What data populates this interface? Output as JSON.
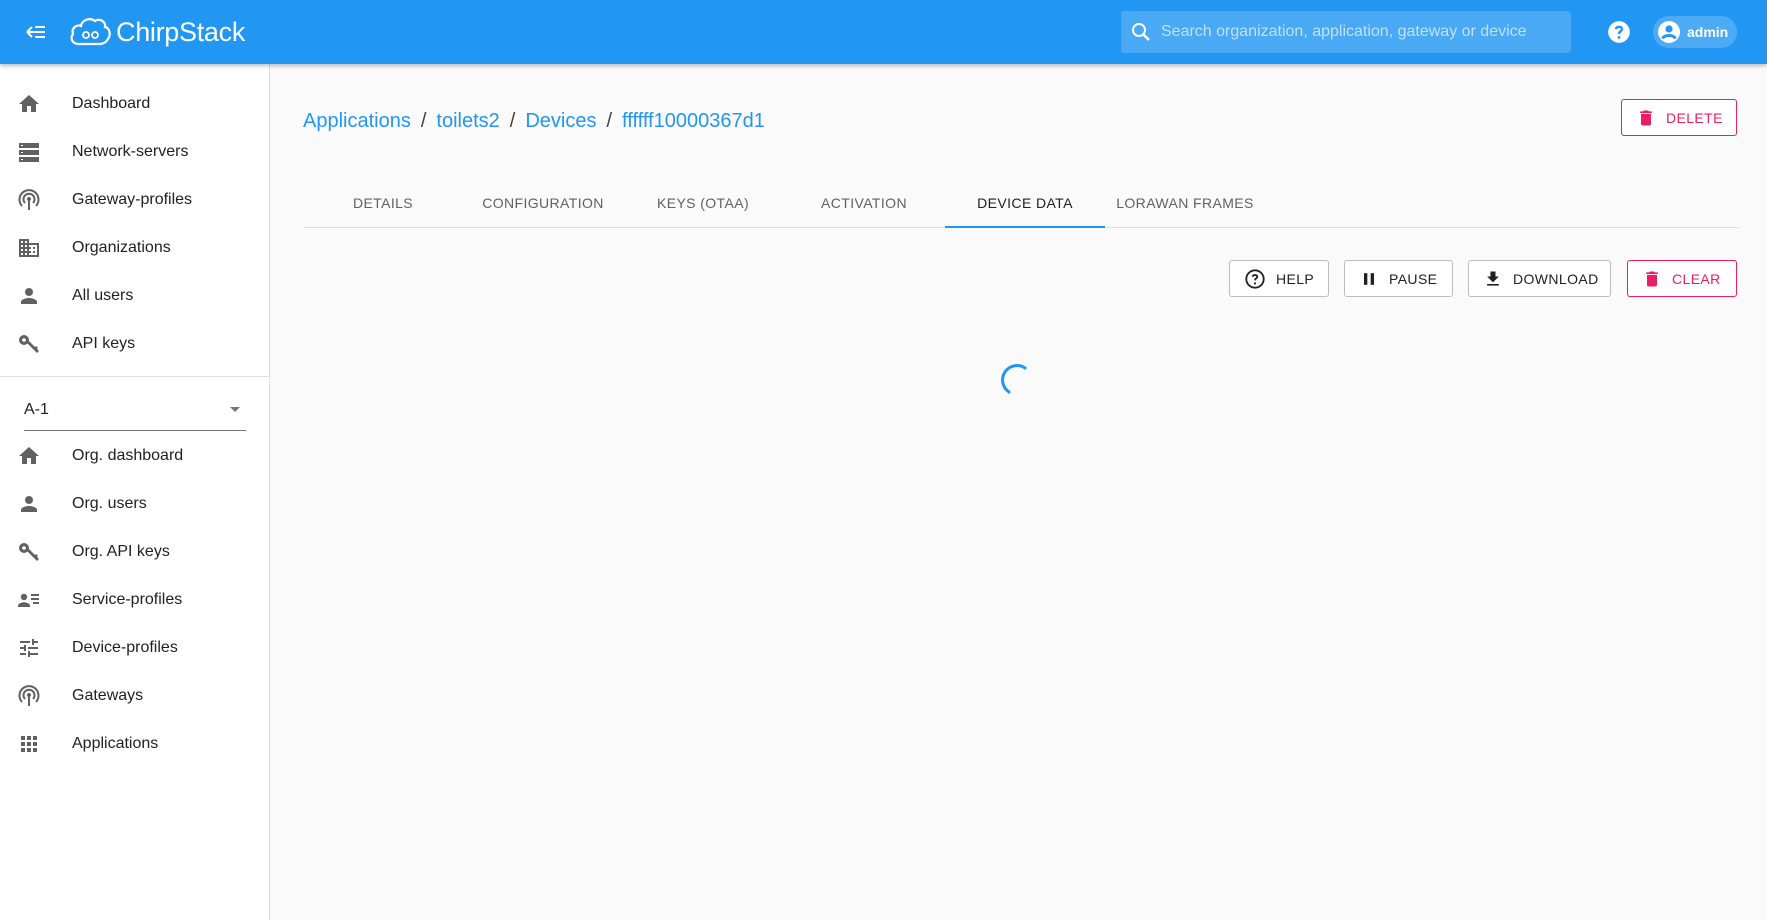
{
  "app": {
    "logo_text": "ChirpStack"
  },
  "search": {
    "placeholder": "Search organization, application, gateway or device"
  },
  "user": {
    "name": "admin"
  },
  "sidebar": {
    "items": [
      {
        "label": "Dashboard",
        "icon": "home-icon"
      },
      {
        "label": "Network-servers",
        "icon": "server-icon"
      },
      {
        "label": "Gateway-profiles",
        "icon": "radio-tower-icon"
      },
      {
        "label": "Organizations",
        "icon": "domain-icon"
      },
      {
        "label": "All users",
        "icon": "account-icon"
      },
      {
        "label": "API keys",
        "icon": "key-icon"
      }
    ],
    "org_select": {
      "value": "A-1"
    },
    "org_items": [
      {
        "label": "Org. dashboard",
        "icon": "home-icon"
      },
      {
        "label": "Org. users",
        "icon": "account-icon"
      },
      {
        "label": "Org. API keys",
        "icon": "key-icon"
      },
      {
        "label": "Service-profiles",
        "icon": "account-details-icon"
      },
      {
        "label": "Device-profiles",
        "icon": "tune-icon"
      },
      {
        "label": "Gateways",
        "icon": "radio-tower-icon"
      },
      {
        "label": "Applications",
        "icon": "apps-icon"
      }
    ]
  },
  "breadcrumb": {
    "items": [
      "Applications",
      "toilets2",
      "Devices",
      "ffffff10000367d1"
    ],
    "separator": "/"
  },
  "actions": {
    "delete_label": "DELETE",
    "help_label": "HELP",
    "pause_label": "PAUSE",
    "download_label": "DOWNLOAD",
    "clear_label": "CLEAR"
  },
  "tabs": [
    {
      "label": "DETAILS",
      "active": false
    },
    {
      "label": "CONFIGURATION",
      "active": false
    },
    {
      "label": "KEYS (OTAA)",
      "active": false
    },
    {
      "label": "ACTIVATION",
      "active": false
    },
    {
      "label": "DEVICE DATA",
      "active": true
    },
    {
      "label": "LORAWAN FRAMES",
      "active": false
    }
  ],
  "colors": {
    "primary": "#2196f3",
    "danger": "#e91e63",
    "icon": "#616161"
  }
}
